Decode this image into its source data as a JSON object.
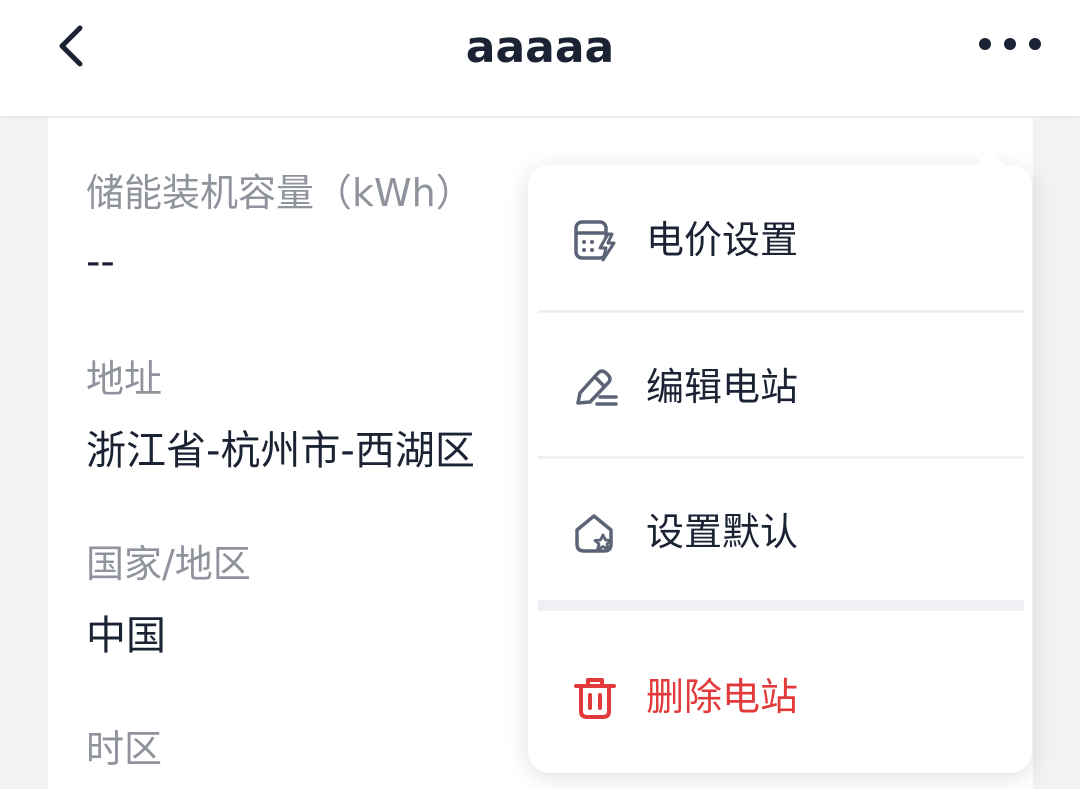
{
  "header": {
    "title": "aaaaa"
  },
  "fields": [
    {
      "label": "储能装机容量（kWh）",
      "value": "--"
    },
    {
      "label": "地址",
      "value": "浙江省-杭州市-西湖区"
    },
    {
      "label": "国家/地区",
      "value": "中国"
    },
    {
      "label": "时区",
      "value": ""
    }
  ],
  "menu": {
    "items": [
      {
        "label": "电价设置",
        "icon": "calculator-bolt-icon"
      },
      {
        "label": "编辑电站",
        "icon": "pencil-edit-icon"
      },
      {
        "label": "设置默认",
        "icon": "home-star-icon"
      },
      {
        "label": "删除电站",
        "icon": "trash-icon"
      }
    ]
  },
  "colors": {
    "text_primary": "#1b2233",
    "text_secondary": "#8f939b",
    "danger": "#e23a3a",
    "icon": "#5d6376",
    "background": "#f1f2f4"
  }
}
